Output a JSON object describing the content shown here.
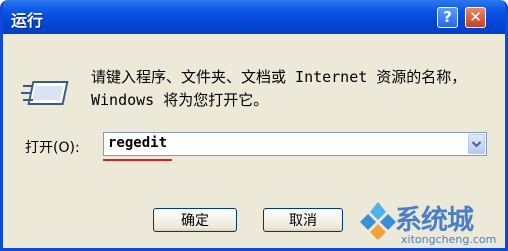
{
  "window": {
    "title": "运行",
    "help_glyph": "?",
    "close_glyph": "✕"
  },
  "dialog": {
    "icon": "run-icon",
    "prompt_text": "请键入程序、文件夹、文档或 Internet 资源的名称，Windows 将为您打开它。",
    "open_label": "打开(O):",
    "open_value": "regedit",
    "ok_label": "确定",
    "cancel_label": "取消"
  },
  "watermark": {
    "brand": "系统城",
    "url": "xitongcheng.com"
  },
  "colors": {
    "titlebar": "#0a54e4",
    "dialog_bg": "#ece9d8",
    "close_button": "#c93f1f",
    "underline": "#d32020",
    "watermark": "#4a7fc5"
  }
}
